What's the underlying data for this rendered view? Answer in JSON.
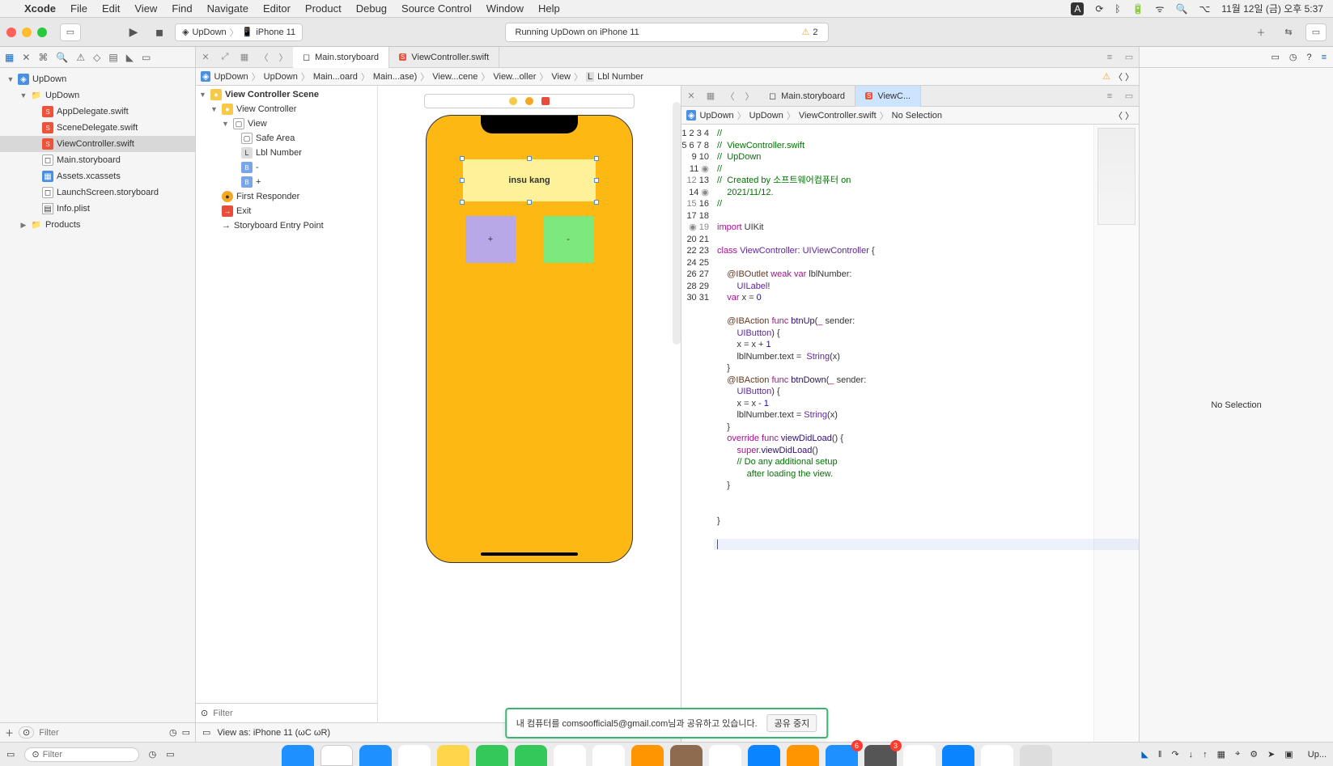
{
  "menubar": {
    "apple": "",
    "app": "Xcode",
    "items": [
      "File",
      "Edit",
      "View",
      "Find",
      "Navigate",
      "Editor",
      "Product",
      "Debug",
      "Source Control",
      "Window",
      "Help"
    ],
    "status_right": {
      "A": "A",
      "date": "11월 12일 (금) 오후 5:37"
    }
  },
  "toolbar": {
    "scheme_app": "UpDown",
    "scheme_device": "iPhone 11",
    "status": "Running UpDown on iPhone 11",
    "warnings": "2"
  },
  "navigator": {
    "project": "UpDown",
    "group": "UpDown",
    "files": [
      "AppDelegate.swift",
      "SceneDelegate.swift",
      "ViewController.swift",
      "Main.storyboard",
      "Assets.xcassets",
      "LaunchScreen.storyboard",
      "Info.plist"
    ],
    "products": "Products",
    "filter_placeholder": "Filter"
  },
  "left_editor": {
    "tabs": {
      "main": "Main.storyboard",
      "vc": "ViewController.swift"
    },
    "jump": [
      "UpDown",
      "UpDown",
      "Main...oard",
      "Main...ase)",
      "View...cene",
      "View...oller",
      "View",
      "Lbl Number"
    ],
    "outline": {
      "scene": "View Controller Scene",
      "vc": "View Controller",
      "view": "View",
      "safe": "Safe Area",
      "lbl": "Lbl Number",
      "minus": "-",
      "plus": "+",
      "first": "First Responder",
      "exit": "Exit",
      "entry": "Storyboard Entry Point"
    },
    "canvas": {
      "label_text": "insu kang",
      "plus": "+",
      "minus": "-",
      "viewas": "View as: iPhone 11 (ωC   ωR)"
    },
    "outline_filter": "Filter"
  },
  "right_editor": {
    "tabs": {
      "main": "Main.storyboard",
      "vc": "ViewC..."
    },
    "jump": [
      "UpDown",
      "UpDown",
      "ViewController.swift",
      "No Selection"
    ],
    "code_lines": [
      "//",
      "//  ViewController.swift",
      "//  UpDown",
      "//",
      "//  Created by 소프트웨어컴퓨터 on\n        2021/11/12.",
      "//",
      "",
      "import UIKit",
      "",
      "class ViewController: UIViewController {",
      "",
      "    @IBOutlet weak var lblNumber:\n        UILabel!",
      "    var x = 0",
      "",
      "    @IBAction func btnUp(_ sender:\n        UIButton) {",
      "        x = x + 1",
      "        lblNumber.text =  String(x)",
      "    }",
      "    @IBAction func btnDown(_ sender:\n        UIButton) {",
      "        x = x - 1",
      "        lblNumber.text = String(x)",
      "    }",
      "    override func viewDidLoad() {",
      "        super.viewDidLoad()",
      "        // Do any additional setup\n            after loading the view.",
      "    }",
      "",
      "",
      "}",
      "",
      "|"
    ],
    "line_numbers": [
      "1",
      "2",
      "3",
      "4",
      "5",
      "6",
      "7",
      "8",
      "9",
      "10",
      "11",
      "12",
      "13",
      "14",
      "15",
      "16",
      "17",
      "18",
      "19",
      "20",
      "21",
      "22",
      "23",
      "24",
      "25",
      "26",
      "27",
      "28",
      "29",
      "30",
      "31"
    ]
  },
  "inspector": {
    "empty": "No Selection"
  },
  "debug": {
    "filter_placeholder": "Filter"
  },
  "toast": {
    "msg": "내 컴퓨터를 comsoofficial5@gmail.com님과 공유하고 있습니다.",
    "btn": "공유 중지"
  }
}
